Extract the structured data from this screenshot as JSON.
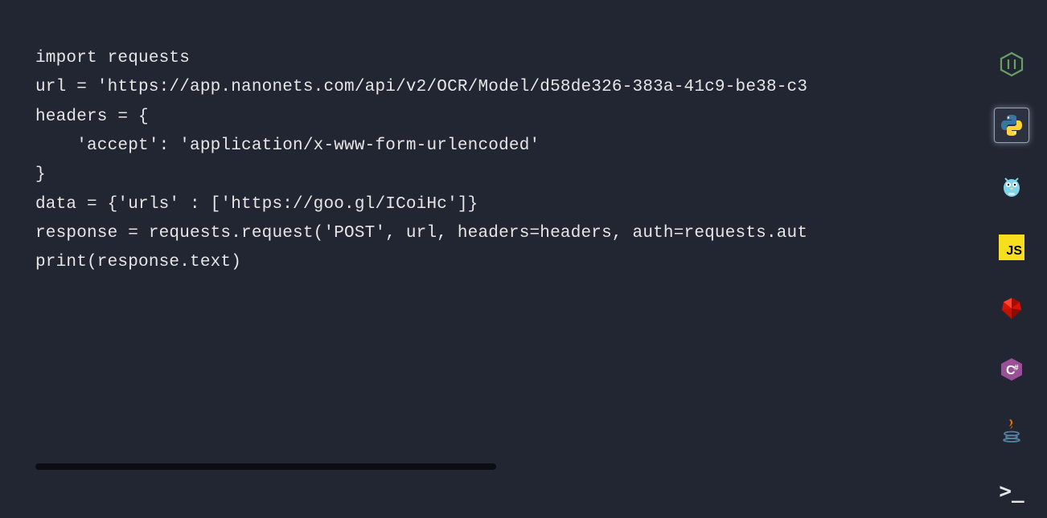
{
  "code": {
    "lines": [
      "import requests",
      "",
      "url = 'https://app.nanonets.com/api/v2/OCR/Model/d58de326-383a-41c9-be38-c3",
      "",
      "headers = {",
      "    'accept': 'application/x-www-form-urlencoded'",
      "}",
      "",
      "data = {'urls' : ['https://goo.gl/ICoiHc']}",
      "",
      "response = requests.request('POST', url, headers=headers, auth=requests.aut",
      "",
      "print(response.text)"
    ]
  },
  "languages": [
    {
      "id": "nodejs",
      "label": "Node.js",
      "selected": false
    },
    {
      "id": "python",
      "label": "Python",
      "selected": true
    },
    {
      "id": "golang",
      "label": "Go",
      "selected": false
    },
    {
      "id": "javascript",
      "label": "JavaScript",
      "selected": false
    },
    {
      "id": "ruby",
      "label": "Ruby",
      "selected": false
    },
    {
      "id": "csharp",
      "label": "C#",
      "selected": false
    },
    {
      "id": "java",
      "label": "Java",
      "selected": false
    },
    {
      "id": "shell",
      "label": "Shell",
      "selected": false
    }
  ],
  "js_tile_text": "JS",
  "shell_prompt": ">_"
}
